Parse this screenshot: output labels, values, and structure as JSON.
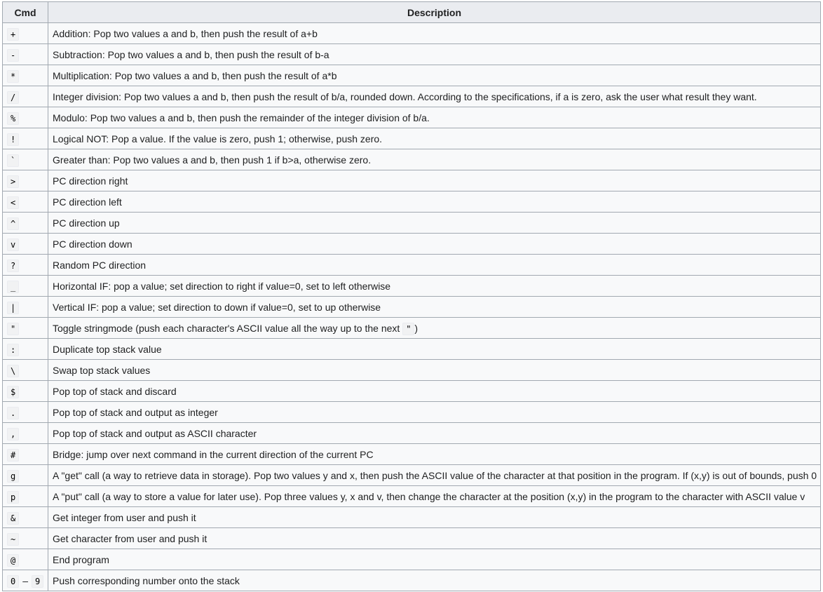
{
  "table": {
    "headers": [
      "Cmd",
      "Description"
    ],
    "rows": [
      {
        "cmd": "+",
        "desc": "Addition: Pop two values a and b, then push the result of a+b"
      },
      {
        "cmd": "-",
        "desc": "Subtraction: Pop two values a and b, then push the result of b-a"
      },
      {
        "cmd": "*",
        "desc": "Multiplication: Pop two values a and b, then push the result of a*b"
      },
      {
        "cmd": "/",
        "desc": "Integer division: Pop two values a and b, then push the result of b/a, rounded down. According to the specifications, if a is zero, ask the user what result they want."
      },
      {
        "cmd": "%",
        "desc": "Modulo: Pop two values a and b, then push the remainder of the integer division of b/a."
      },
      {
        "cmd": "!",
        "desc": "Logical NOT: Pop a value. If the value is zero, push 1; otherwise, push zero."
      },
      {
        "cmd": "`",
        "desc": "Greater than: Pop two values a and b, then push 1 if b>a, otherwise zero."
      },
      {
        "cmd": ">",
        "desc": "PC direction right"
      },
      {
        "cmd": "<",
        "desc": "PC direction left"
      },
      {
        "cmd": "^",
        "desc": "PC direction up"
      },
      {
        "cmd": "v",
        "desc": "PC direction down"
      },
      {
        "cmd": "?",
        "desc": "Random PC direction"
      },
      {
        "cmd": "_",
        "desc": "Horizontal IF: pop a value; set direction to right if value=0, set to left otherwise"
      },
      {
        "cmd": "|",
        "desc": "Vertical IF: pop a value; set direction to down if value=0, set to up otherwise"
      },
      {
        "cmd": "\"",
        "desc": "Toggle stringmode (push each character's ASCII value all the way up to the next ",
        "desc_code": "\"",
        "desc_after": ")"
      },
      {
        "cmd": ":",
        "desc": "Duplicate top stack value"
      },
      {
        "cmd": "\\",
        "desc": "Swap top stack values"
      },
      {
        "cmd": "$",
        "desc": "Pop top of stack and discard"
      },
      {
        "cmd": ".",
        "desc": "Pop top of stack and output as integer"
      },
      {
        "cmd": ",",
        "desc": "Pop top of stack and output as ASCII character"
      },
      {
        "cmd": "#",
        "desc": "Bridge: jump over next command in the current direction of the current PC"
      },
      {
        "cmd": "g",
        "desc": "A \"get\" call (a way to retrieve data in storage). Pop two values y and x, then push the ASCII value of the character at that position in the program. If (x,y) is out of bounds, push 0"
      },
      {
        "cmd": "p",
        "desc": "A \"put\" call (a way to store a value for later use). Pop three values y, x and v, then change the character at the position (x,y) in the program to the character with ASCII value v"
      },
      {
        "cmd": "&",
        "desc": "Get integer from user and push it"
      },
      {
        "cmd": "~",
        "desc": "Get character from user and push it"
      },
      {
        "cmd": "@",
        "desc": "End program"
      },
      {
        "cmd": "0",
        "cmd_sep": "–",
        "cmd_end": "9",
        "desc": "Push corresponding number onto the stack"
      }
    ]
  }
}
